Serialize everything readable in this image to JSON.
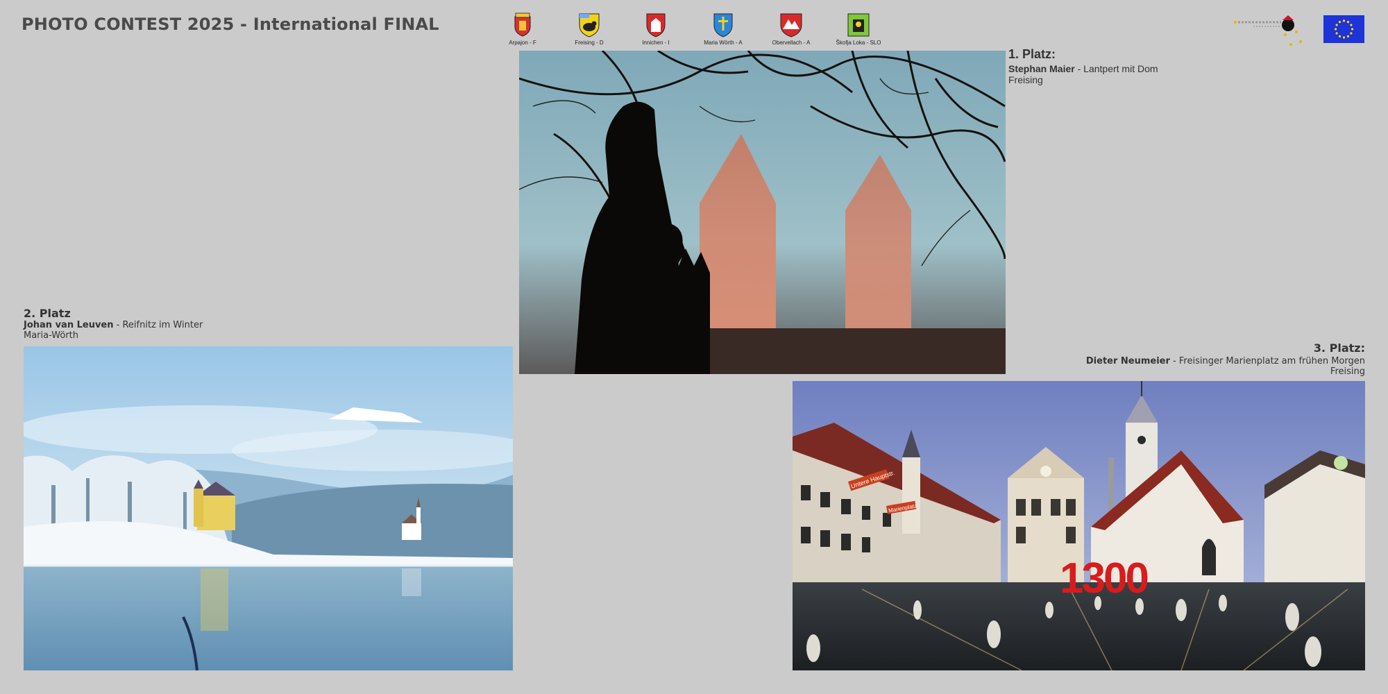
{
  "header": {
    "title": "PHOTO CONTEST 2025 - International FINAL"
  },
  "partners": [
    {
      "name": "Arpajon - F",
      "icon": "arpajon-crest-icon",
      "color": "#d93030",
      "accent": "#f0c63b"
    },
    {
      "name": "Freising - D",
      "icon": "freising-crest-icon",
      "color": "#f2d21b",
      "accent": "#222222"
    },
    {
      "name": "Innichen - I",
      "icon": "innichen-crest-icon",
      "color": "#d92a2a",
      "accent": "#ffffff"
    },
    {
      "name": "Maria Wörth - A",
      "icon": "maria-woerth-crest-icon",
      "color": "#2a86d9",
      "accent": "#f2d21b"
    },
    {
      "name": "Obervellach - A",
      "icon": "obervellach-crest-icon",
      "color": "#d92a2a",
      "accent": "#ffffff"
    },
    {
      "name": "Škofja Loka - SLO",
      "icon": "skofja-loka-crest-icon",
      "color": "#7ec83a",
      "accent": "#f2d21b"
    }
  ],
  "logos": {
    "partnership_icon": "town-partnership-logo-icon",
    "eu_icon": "eu-flag-icon",
    "eu_color": "#1e33d8"
  },
  "winners": {
    "first": {
      "place": "1. Platz:",
      "author": "Stephan Maier",
      "sep": " - ",
      "photo_title": "Lantpert mit Dom",
      "town": "Freising"
    },
    "second": {
      "place": "2. Platz",
      "author": "Johan van Leuven",
      "sep": " - ",
      "photo_title": "Reifnitz im Winter",
      "town": "Maria-Wörth"
    },
    "third": {
      "place": "3. Platz:",
      "author": "Dieter Neumeier",
      "sep": " - ",
      "photo_title": "Freisinger Marienplatz am frühen Morgen",
      "town": "Freising"
    }
  },
  "photo_signs": {
    "number": "1300",
    "street_sign_1": "Untere Hauptstr.",
    "street_sign_2": "Marienplatz"
  }
}
